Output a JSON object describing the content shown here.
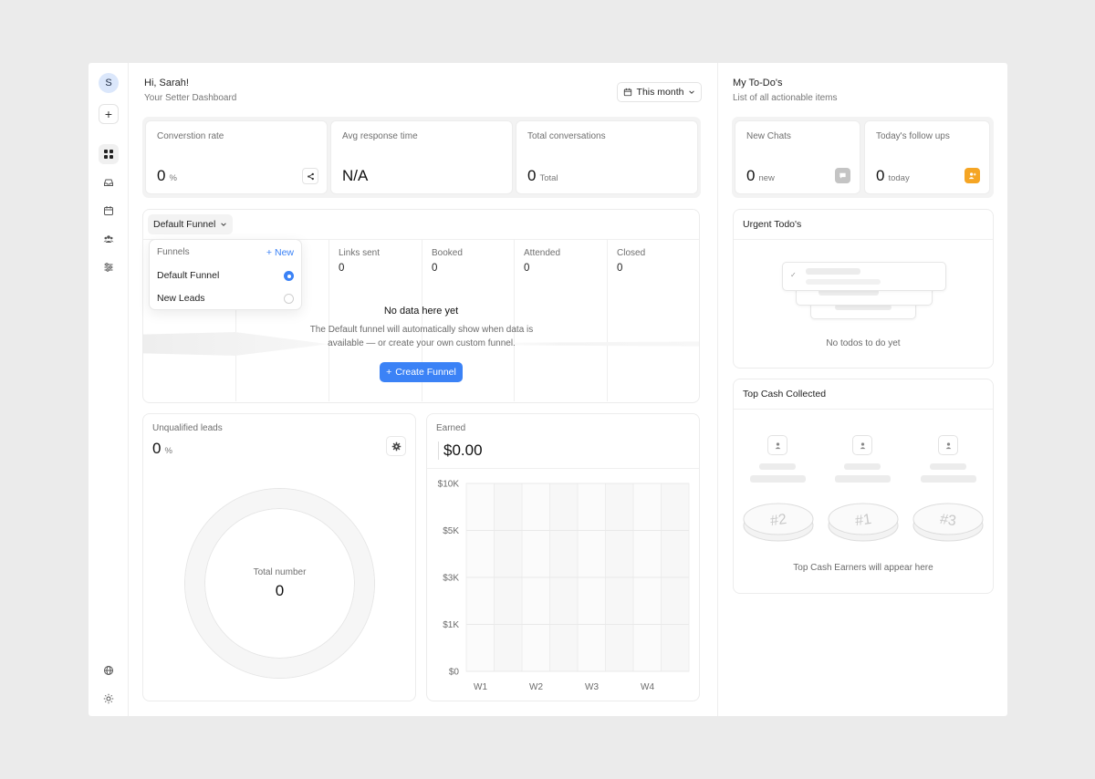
{
  "user": {
    "initial": "S"
  },
  "header": {
    "greeting": "Hi, Sarah!",
    "subtitle": "Your Setter Dashboard",
    "period": "This month"
  },
  "stats": [
    {
      "label": "Converstion rate",
      "value": "0",
      "unit": "%"
    },
    {
      "label": "Avg response time",
      "value": "N/A",
      "unit": ""
    },
    {
      "label": "Total conversations",
      "value": "0",
      "unit": "Total"
    }
  ],
  "funnel": {
    "selected": "Default Funnel",
    "columns": [
      {
        "label": "Links sent",
        "value": "0"
      },
      {
        "label": "Booked",
        "value": "0"
      },
      {
        "label": "Attended",
        "value": "0"
      },
      {
        "label": "Closed",
        "value": "0"
      }
    ],
    "empty_title": "No data here yet",
    "empty_desc": "The Default funnel will automatically show when data is available — or create your own custom funnel.",
    "create_label": "Create Funnel",
    "dropdown": {
      "title": "Funnels",
      "new_label": "New",
      "items": [
        {
          "label": "Default Funnel",
          "selected": true
        },
        {
          "label": "New Leads",
          "selected": false
        }
      ]
    }
  },
  "unqualified": {
    "label": "Unqualified leads",
    "value": "0",
    "unit": "%",
    "center_label": "Total number",
    "center_value": "0"
  },
  "earned": {
    "label": "Earned",
    "value": "$0.00"
  },
  "chart_data": {
    "type": "bar",
    "categories": [
      "W1",
      "W2",
      "W3",
      "W4"
    ],
    "values": [
      0,
      0,
      0,
      0
    ],
    "yticks": [
      "$0",
      "$1K",
      "$3K",
      "$5K",
      "$10K"
    ],
    "title": "Earned",
    "grid": true
  },
  "todos": {
    "title": "My To-Do's",
    "subtitle": "List of all actionable items",
    "cards": [
      {
        "label": "New Chats",
        "value": "0",
        "unit": "new",
        "color": "#c4c4c4"
      },
      {
        "label": "Today's follow ups",
        "value": "0",
        "unit": "today",
        "color": "#f5a524"
      }
    ],
    "urgent_title": "Urgent Todo's",
    "urgent_empty": "No todos to do yet"
  },
  "cash": {
    "title": "Top Cash Collected",
    "ranks": [
      "#2",
      "#1",
      "#3"
    ],
    "empty": "Top Cash Earners will appear here"
  },
  "colors": {
    "accent": "#3b82f6",
    "followup": "#f5a524"
  }
}
